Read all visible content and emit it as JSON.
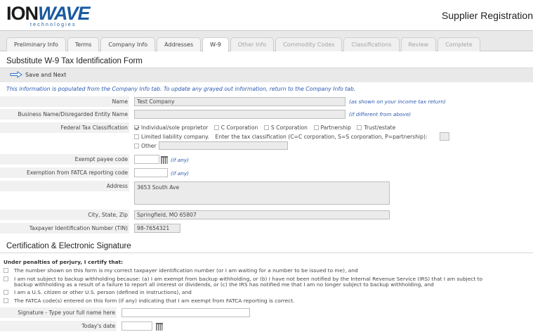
{
  "header": {
    "logo_main_a": "ION",
    "logo_main_b": "WAVE",
    "logo_sub": "technologies",
    "app_title": "Supplier Registration"
  },
  "tabs": [
    {
      "label": "Preliminary Info",
      "state": "normal"
    },
    {
      "label": "Terms",
      "state": "normal"
    },
    {
      "label": "Company Info",
      "state": "normal"
    },
    {
      "label": "Addresses",
      "state": "normal"
    },
    {
      "label": "W-9",
      "state": "active"
    },
    {
      "label": "Other Info",
      "state": "disabled"
    },
    {
      "label": "Commodity Codes",
      "state": "disabled"
    },
    {
      "label": "Classifications",
      "state": "disabled"
    },
    {
      "label": "Review",
      "state": "disabled"
    },
    {
      "label": "Complete",
      "state": "disabled"
    }
  ],
  "form": {
    "title": "Substitute W-9 Tax Identification Form",
    "save_label": "Save and Next",
    "info_text": "This information is populated from the Company Info tab. To update any grayed out information, return to the Company Info tab.",
    "name_label": "Name",
    "name_value": "Test Company",
    "name_hint": "(as shown on your income tax return)",
    "business_label": "Business Name/Disregarded Entity Name",
    "business_value": "",
    "business_hint": "(if different from above)",
    "fed_label": "Federal Tax Classification",
    "fed_options": {
      "individual": "Individual/sole proprietor",
      "c_corp": "C Corporation",
      "s_corp": "S Corporation",
      "partnership": "Partnership",
      "trust": "Trust/estate",
      "llc": "Limited liability company.",
      "llc_enter": "Enter the tax classification (C=C corporation, S=S corporation, P=partnership):",
      "other": "Other"
    },
    "exempt_payee_label": "Exempt payee code",
    "exempt_payee_hint": "(if any)",
    "fatca_label": "Exemption from FATCA reporting code",
    "fatca_hint": "(if any)",
    "address_label": "Address",
    "address_value": "3653 South Ave",
    "city_label": "City, State, Zip",
    "city_value": "Springfield, MO 65807",
    "tin_label": "Taxpayer Identification Number (TIN)",
    "tin_value": "98-7654321"
  },
  "certification": {
    "title": "Certification & Electronic Signature",
    "lead": "Under penalties of perjury, I certify that:",
    "item1": "The number shown on this form is my correct taxpayer identification number (or I am waiting for a number to be issued to me), and",
    "item2a": "I am not subject to backup withholding because: (a) I am exempt from backup withholding, or (b) I have not been notified by the Internal Revenue Service (IRS) that I am subject to",
    "item2b": "backup withholding as a result of a failure to report all interest or dividends, or (c) the IRS has notified me that I am no longer subject to backup withholding, and",
    "item3": "I am a U.S. citizen or other U.S. person (defined in instructions), and",
    "item4": "The FATCA code(s) entered on this form (if any) indicating that I am exempt from FATCA reporting is correct.",
    "signature_label": "Signature - Type your full name here",
    "signature_value": "",
    "date_label": "Today's date",
    "date_value": ""
  }
}
